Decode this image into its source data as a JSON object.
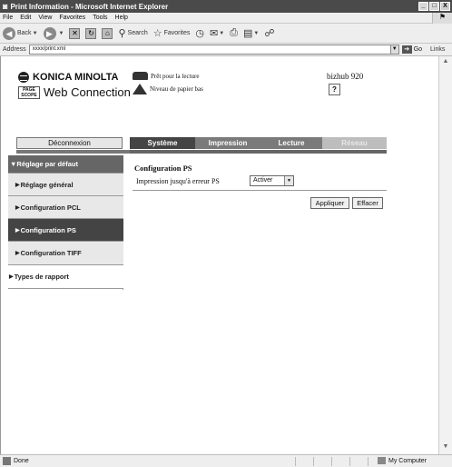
{
  "window": {
    "title": "Print Information - Microsoft Internet Explorer",
    "buttons": [
      "_",
      "□",
      "X"
    ]
  },
  "menu": [
    "File",
    "Edit",
    "View",
    "Favorites",
    "Tools",
    "Help"
  ],
  "toolbar": {
    "back": "Back",
    "search": "Search",
    "favorites": "Favorites"
  },
  "address": {
    "label": "Address",
    "url": "xxxx/print.xml",
    "go": "Go",
    "links": "Links"
  },
  "header": {
    "brand": "KONICA MINOLTA",
    "pagescope_badge": "PAGE SCOPE",
    "product": "Web Connection",
    "status_ready": "Prêt pour la lecture",
    "status_paper": "Niveau de papier bas",
    "model": "bizhub 920",
    "help": "?"
  },
  "nav": {
    "logout": "Déconnexion",
    "tabs": [
      {
        "label": "Système"
      },
      {
        "label": "Impression"
      },
      {
        "label": "Lecture"
      },
      {
        "label": "Réseau"
      }
    ]
  },
  "sidebar": {
    "items": [
      {
        "label": "▼Réglage par défaut"
      },
      {
        "label": "Réglage général"
      },
      {
        "label": "Configuration PCL"
      },
      {
        "label": "Configuration PS"
      },
      {
        "label": "Configuration TIFF"
      },
      {
        "label": "Types de rapport"
      }
    ]
  },
  "main": {
    "title": "Configuration PS",
    "field_label": "Impression jusqu'à erreur PS",
    "field_value": "Activer",
    "apply": "Appliquer",
    "clear": "Effacer"
  },
  "statusbar": {
    "left": "Done",
    "zone": "My Computer"
  }
}
